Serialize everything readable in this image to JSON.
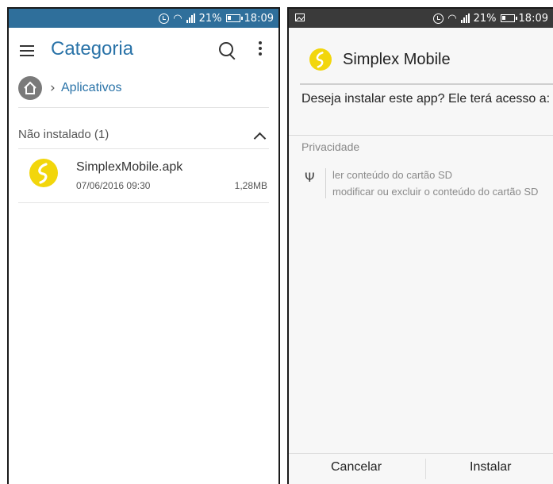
{
  "status": {
    "battery": "21%",
    "time": "18:09"
  },
  "left": {
    "appbar": {
      "title": "Categoria"
    },
    "breadcrumb": {
      "current": "Aplicativos"
    },
    "section": {
      "label": "Não instalado (1)"
    },
    "files": [
      {
        "name": "SimplexMobile.apk",
        "date": "07/06/2016 09:30",
        "size": "1,28MB"
      }
    ]
  },
  "right": {
    "dialog": {
      "app_name": "Simplex Mobile",
      "message": "Deseja instalar este app? Ele terá acesso a:",
      "section_label": "Privacidade",
      "permissions": [
        "ler conteúdo do cartão SD",
        "modificar ou excluir o conteúdo do cartão SD"
      ],
      "cancel_label": "Cancelar",
      "install_label": "Instalar"
    }
  },
  "colors": {
    "accent": "#2a73a8",
    "status_bar_left": "#2f6f9b",
    "status_bar_right": "#3a3a3a",
    "app_icon": "#f2d60c"
  }
}
